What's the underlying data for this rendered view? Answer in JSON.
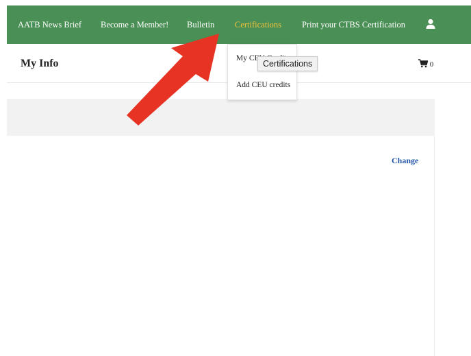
{
  "nav": {
    "items": [
      {
        "label": "AATB News Brief"
      },
      {
        "label": "Become a Member!"
      },
      {
        "label": "Bulletin"
      },
      {
        "label": "Certifications"
      },
      {
        "label": "Print your CTBS Certification"
      }
    ],
    "active_color": "#f3c13a",
    "bg_color": "#4a8f55",
    "user_icon": "user-icon"
  },
  "header": {
    "title": "My Info",
    "cart_icon": "cart-icon",
    "cart_count": "0"
  },
  "dropdown": {
    "items": [
      {
        "label": "My CEU Credits"
      },
      {
        "label": "Add CEU credits"
      }
    ]
  },
  "tooltip": {
    "text": "Certifications"
  },
  "content": {
    "change_label": "Change"
  },
  "annotation": {
    "arrow_color": "#e63323"
  }
}
